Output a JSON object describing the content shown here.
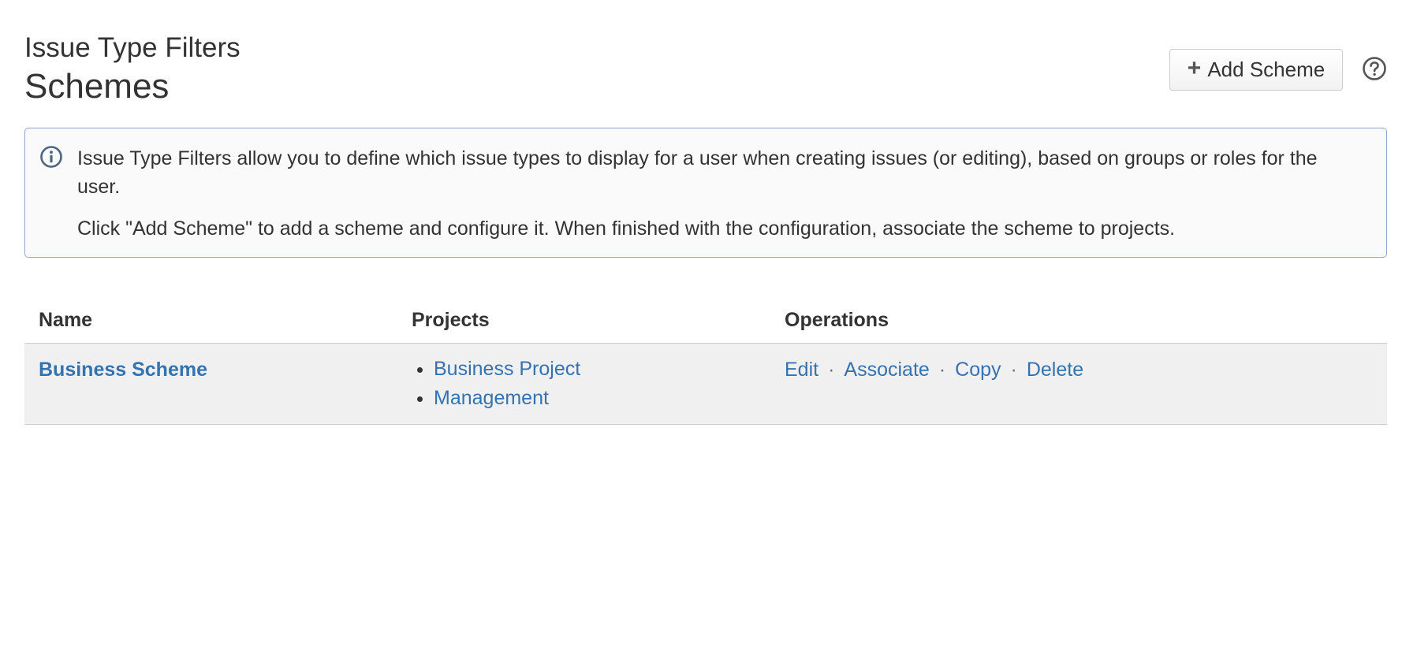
{
  "header": {
    "subtitle": "Issue Type Filters",
    "title": "Schemes"
  },
  "toolbar": {
    "add_scheme_label": "Add Scheme",
    "add_icon": "plus-icon",
    "help_icon": "question-mark-icon"
  },
  "info": {
    "icon": "info-circle-icon",
    "line1": "Issue Type Filters allow you to define which issue types to display for a user when creating issues (or editing), based on groups or roles for the user.",
    "line2": "Click \"Add Scheme\" to add a scheme and configure it. When finished with the configuration, associate the scheme to projects."
  },
  "table": {
    "headers": {
      "name": "Name",
      "projects": "Projects",
      "operations": "Operations"
    },
    "rows": [
      {
        "name": "Business Scheme",
        "projects": [
          "Business Project",
          "Management"
        ],
        "operations": {
          "edit": "Edit",
          "associate": "Associate",
          "copy": "Copy",
          "delete": "Delete",
          "separator": "·"
        }
      }
    ]
  },
  "colors": {
    "link": "#3572b0",
    "text": "#333333",
    "info_border": "#94a8c9",
    "row_bg": "#f0f0f0"
  }
}
